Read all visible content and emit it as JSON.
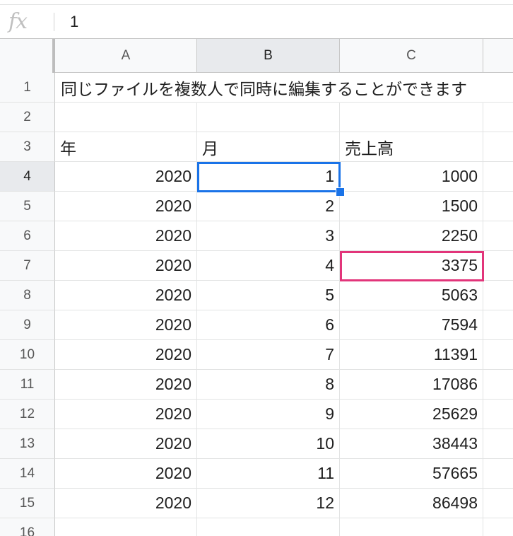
{
  "formula_bar": {
    "icon": "fx-icon",
    "icon_text": "fx",
    "value": "1"
  },
  "columns": [
    "A",
    "B",
    "C"
  ],
  "title_text": "同じファイルを複数人で同時に編集することができます",
  "header_row": [
    "年",
    "月",
    "売上高"
  ],
  "row_numbers": [
    "1",
    "2",
    "3",
    "4",
    "5",
    "6",
    "7",
    "8",
    "9",
    "10",
    "11",
    "12",
    "13",
    "14",
    "15",
    "16"
  ],
  "data_rows": [
    {
      "a": "2020",
      "b": "1",
      "c": "1000"
    },
    {
      "a": "2020",
      "b": "2",
      "c": "1500"
    },
    {
      "a": "2020",
      "b": "3",
      "c": "2250"
    },
    {
      "a": "2020",
      "b": "4",
      "c": "3375"
    },
    {
      "a": "2020",
      "b": "5",
      "c": "5063"
    },
    {
      "a": "2020",
      "b": "6",
      "c": "7594"
    },
    {
      "a": "2020",
      "b": "7",
      "c": "11391"
    },
    {
      "a": "2020",
      "b": "8",
      "c": "17086"
    },
    {
      "a": "2020",
      "b": "9",
      "c": "25629"
    },
    {
      "a": "2020",
      "b": "10",
      "c": "38443"
    },
    {
      "a": "2020",
      "b": "11",
      "c": "57665"
    },
    {
      "a": "2020",
      "b": "12",
      "c": "86498"
    }
  ],
  "colors": {
    "selection": "#1a73e8",
    "highlight": "#e2357a"
  }
}
